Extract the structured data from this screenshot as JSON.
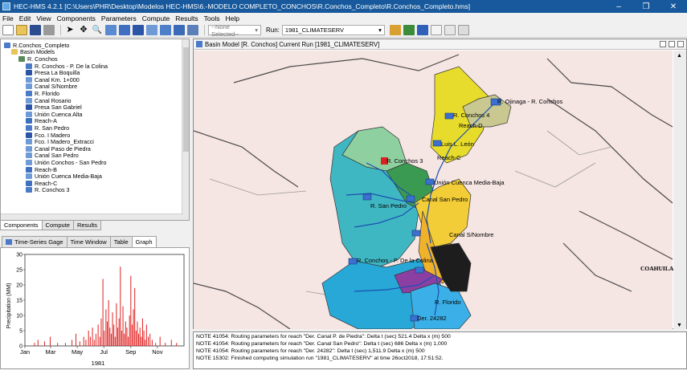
{
  "window": {
    "title": "HEC-HMS 4.2.1 [C:\\Users\\PHR\\Desktop\\Modelos HEC-HMS\\6.-MODELO COMPLETO_CONCHOS\\R.Conchos_Completo\\R.Conchos_Completo.hms]"
  },
  "menu": [
    "File",
    "Edit",
    "View",
    "Components",
    "Parameters",
    "Compute",
    "Results",
    "Tools",
    "Help"
  ],
  "toolbar": {
    "selector_value": "--None Selected--",
    "run_label": "Run:",
    "run_value": "1981_CLIMATESERV"
  },
  "tree": {
    "items": [
      {
        "label": "R.Conchos_Completo",
        "level": 0,
        "icon": "project-icon"
      },
      {
        "label": "Basin Models",
        "level": 1,
        "icon": "folder-icon"
      },
      {
        "label": "R. Conchos",
        "level": 2,
        "icon": "basin-icon"
      },
      {
        "label": "R. Conchos - P. De la Colina",
        "level": 3,
        "icon": "subbasin-icon"
      },
      {
        "label": "Presa La Boquilla",
        "level": 3,
        "icon": "reservoir-icon"
      },
      {
        "label": "Canal Km. 1+000",
        "level": 3,
        "icon": "junction-icon"
      },
      {
        "label": "Canal S/Nombre",
        "level": 3,
        "icon": "junction-icon"
      },
      {
        "label": "R. Florido",
        "level": 3,
        "icon": "subbasin-icon"
      },
      {
        "label": "Canal Rosario",
        "level": 3,
        "icon": "junction-icon"
      },
      {
        "label": "Presa San Gabriel",
        "level": 3,
        "icon": "reservoir-icon"
      },
      {
        "label": "Unión Cuenca Alta",
        "level": 3,
        "icon": "junction-icon"
      },
      {
        "label": "Reach-A",
        "level": 3,
        "icon": "reach-icon"
      },
      {
        "label": "R. San Pedro",
        "level": 3,
        "icon": "subbasin-icon"
      },
      {
        "label": "Fco. I Madero",
        "level": 3,
        "icon": "reservoir-icon"
      },
      {
        "label": "Fco. I Madero_Extracci",
        "level": 3,
        "icon": "junction-icon"
      },
      {
        "label": "Canal Paso de Piedra",
        "level": 3,
        "icon": "junction-icon"
      },
      {
        "label": "Canal San Pedro",
        "level": 3,
        "icon": "junction-icon"
      },
      {
        "label": "Unión Conchos - San Pedro",
        "level": 3,
        "icon": "junction-icon"
      },
      {
        "label": "Reach-B",
        "level": 3,
        "icon": "reach-icon"
      },
      {
        "label": "Unión Cuenca Media-Baja",
        "level": 3,
        "icon": "junction-icon"
      },
      {
        "label": "Reach-C",
        "level": 3,
        "icon": "reach-icon"
      },
      {
        "label": "R. Conchos 3",
        "level": 3,
        "icon": "subbasin-icon"
      }
    ]
  },
  "left_tabs": [
    "Components",
    "Compute",
    "Results"
  ],
  "left_tab_active": "Components",
  "bottom_tabs": [
    "Time-Series Gage",
    "Time Window",
    "Table",
    "Graph"
  ],
  "bottom_tab_active": "Graph",
  "map": {
    "title": "Basin Model [R. Conchos] Current Run [1981_CLIMATESERV]",
    "labels": [
      "R. Conchos 4",
      "Reach-D",
      "Luis L. León",
      "Reach-C",
      "Unión Cuenca Media-Baja",
      "R. Conchos 3",
      "R. San Pedro",
      "Canal San Pedro",
      "Canal S/Nombre",
      "R. Conchos - P. De la Colina",
      "R. Florido",
      "Der. 24282",
      "COAHUILA",
      "R. Ojinaga - R. Conchos"
    ]
  },
  "console": {
    "lines": [
      "NOTE 41054:  Routing parameters for reach \"Der. Canal P. de Piedra\": Delta t (sec) 521.4  Delta x (m) 500",
      "NOTE 41054:  Routing parameters for reach \"Der. Canal San Pedro\": Delta t (sec) 686  Delta x (m) 1,000",
      "NOTE 41054:  Routing parameters for reach \"Der. 24282\": Delta t (sec) 1,511.9  Delta x (m) 500",
      "NOTE 15302:  Finished computing simulation run \"1981_CLIMATESERV\" at time 26oct2018, 17:51:52."
    ]
  },
  "chart_data": {
    "type": "bar",
    "title": "",
    "xlabel": "1981",
    "ylabel": "Precipitation (MM)",
    "ylim": [
      0,
      30
    ],
    "yticks": [
      0,
      5,
      10,
      15,
      20,
      25,
      30
    ],
    "xticks": [
      "Jan",
      "Mar",
      "May",
      "Jul",
      "Sep",
      "Nov"
    ],
    "series_color": "#e02020",
    "x_unit": "day of year",
    "x": [
      22,
      30,
      45,
      58,
      75,
      93,
      108,
      117,
      126,
      135,
      140,
      146,
      150,
      155,
      159,
      163,
      168,
      172,
      175,
      179,
      182,
      186,
      189,
      192,
      195,
      198,
      201,
      204,
      207,
      210,
      213,
      216,
      219,
      222,
      225,
      228,
      231,
      234,
      237,
      240,
      243,
      246,
      249,
      252,
      255,
      258,
      261,
      264,
      267,
      270,
      273,
      276,
      279,
      283,
      287,
      292,
      300,
      310,
      322,
      336,
      348
    ],
    "values": [
      1,
      2,
      1.5,
      3,
      1,
      1,
      2,
      4,
      1.5,
      3,
      2,
      5,
      3,
      6,
      2,
      4,
      7,
      3,
      9,
      22,
      5,
      12,
      8,
      15,
      6,
      4,
      11,
      7,
      3,
      14,
      6,
      9,
      26,
      5,
      13,
      4,
      8,
      6,
      3,
      10,
      23,
      7,
      12,
      19,
      5,
      8,
      4,
      6,
      3,
      9,
      5,
      2,
      7,
      3,
      4,
      2,
      1,
      3,
      1,
      2,
      1
    ]
  }
}
